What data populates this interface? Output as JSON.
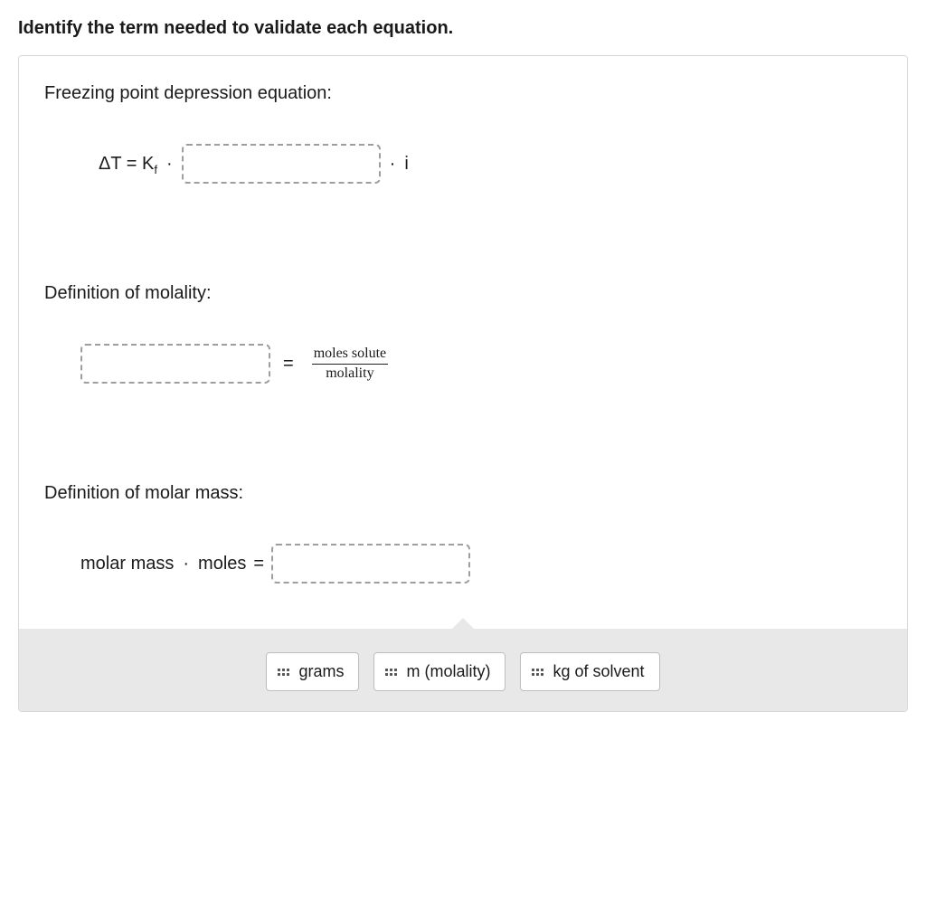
{
  "instruction": "Identify the term needed to validate each equation.",
  "sections": {
    "freezing": {
      "label": "Freezing point depression equation:",
      "lhs_prefix": "ΔT = K",
      "lhs_sub": "f",
      "dot": "·",
      "suffix": "i"
    },
    "molality": {
      "label": "Definition of molality:",
      "equals": "=",
      "fraction_num": "moles solute",
      "fraction_den": "molality"
    },
    "molar_mass": {
      "label": "Definition of molar mass:",
      "lhs": "molar mass",
      "dot": "·",
      "moles": "moles",
      "equals": "="
    }
  },
  "options": {
    "grams": "grams",
    "molality": "m (molality)",
    "kg_solvent": "kg of solvent"
  }
}
